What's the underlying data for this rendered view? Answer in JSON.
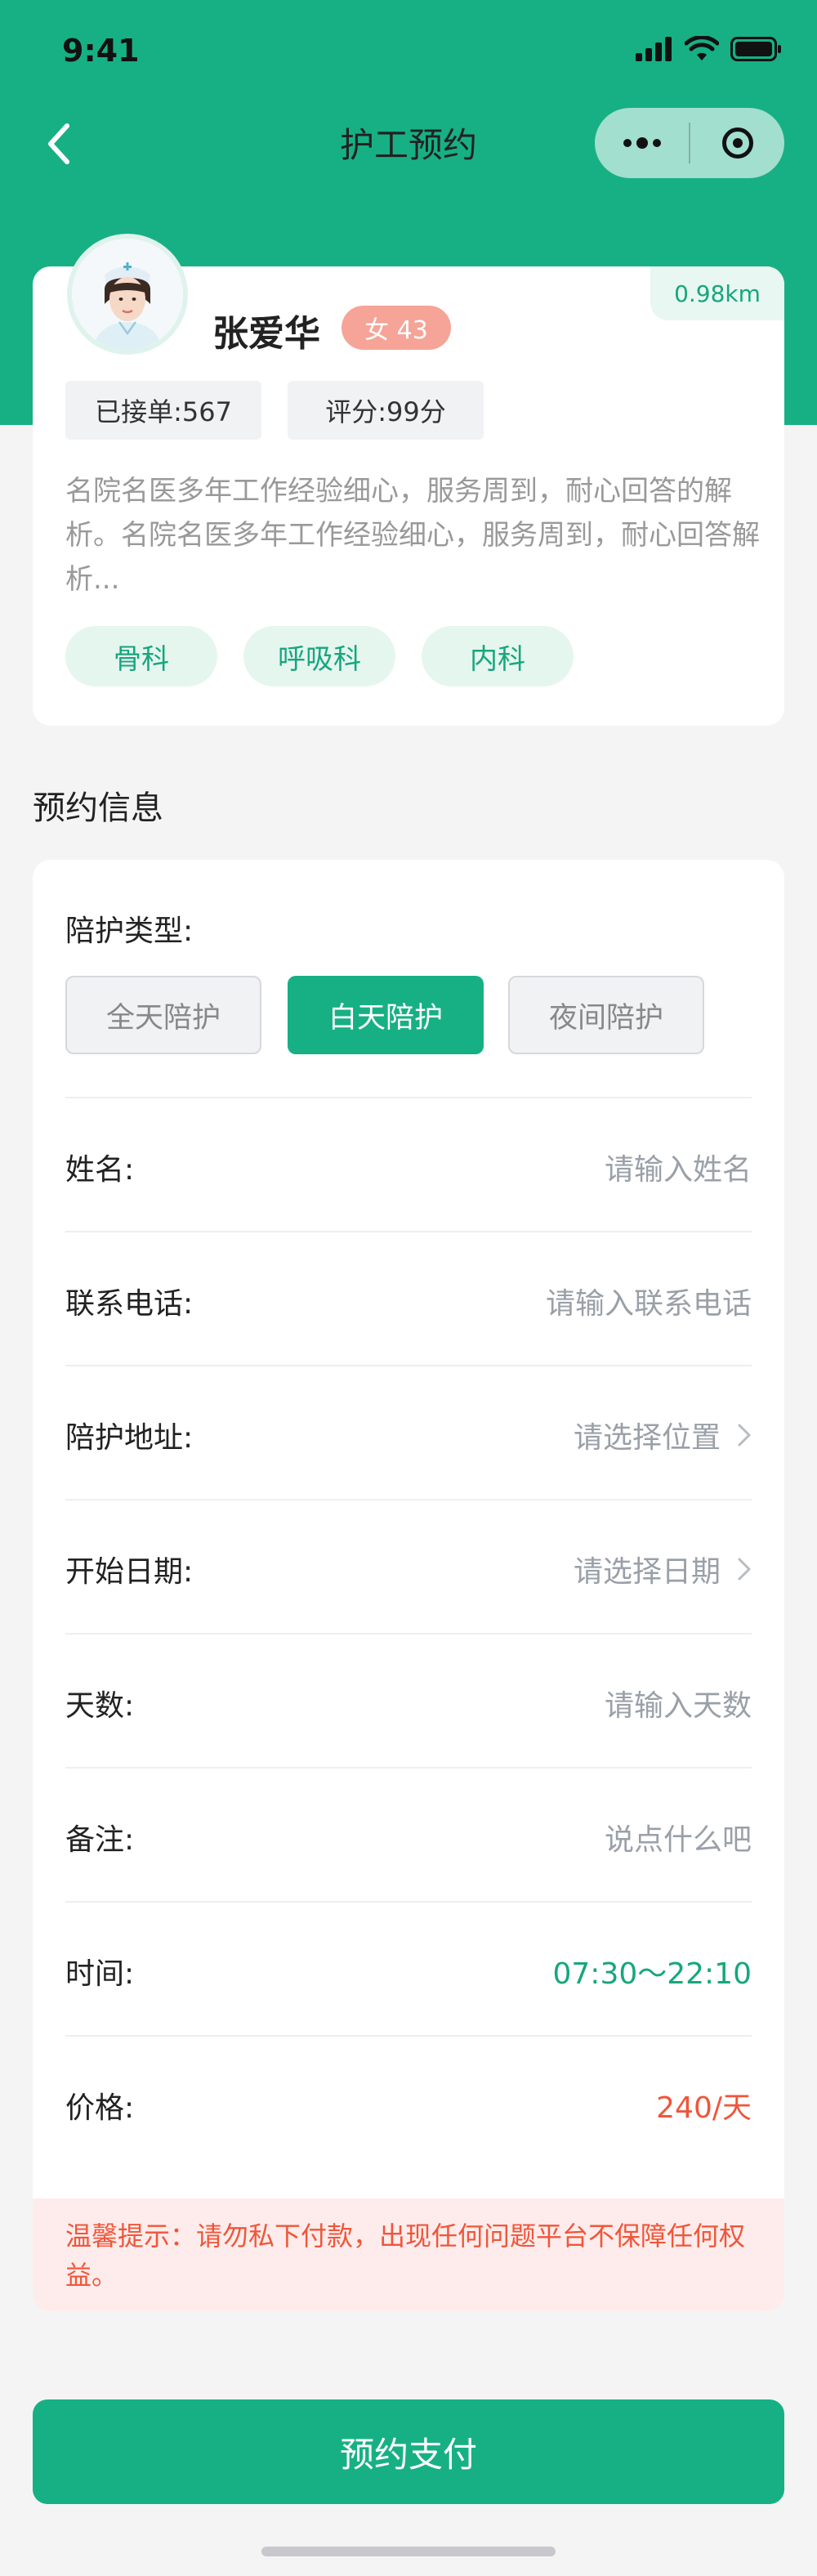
{
  "status_bar": {
    "time": "9:41"
  },
  "nav": {
    "title": "护工预约"
  },
  "profile": {
    "distance": "0.98km",
    "name": "张爱华",
    "gender_age": "女 43",
    "orders": "已接单:567",
    "rating": "评分:99分",
    "description": "名院名医多年工作经验细心，服务周到，耐心回答的解析。名院名医多年工作经验细心，服务周到，耐心回答解析...",
    "tags": [
      "骨科",
      "呼吸科",
      "内科"
    ]
  },
  "section_title": "预约信息",
  "form": {
    "care_type": {
      "label": "陪护类型:",
      "options": [
        "全天陪护",
        "白天陪护",
        "夜间陪护"
      ],
      "selected": "白天陪护"
    },
    "rows": [
      {
        "label": "姓名:",
        "value": "请输入姓名",
        "type": "input"
      },
      {
        "label": "联系电话:",
        "value": "请输入联系电话",
        "type": "input"
      },
      {
        "label": "陪护地址:",
        "value": "请选择位置",
        "type": "select"
      },
      {
        "label": "开始日期:",
        "value": "请选择日期",
        "type": "select"
      },
      {
        "label": "天数:",
        "value": "请输入天数",
        "type": "input"
      },
      {
        "label": "备注:",
        "value": "说点什么吧",
        "type": "input"
      },
      {
        "label": "时间:",
        "value": "07:30～22:10",
        "type": "text"
      },
      {
        "label": "价格:",
        "value": "240/天",
        "type": "text"
      }
    ],
    "notice": "温馨提示：请勿私下付款，出现任何问题平台不保障任何权益。"
  },
  "pay_button": "预约支付",
  "colors": {
    "brand": "#17b084",
    "price": "#f0563a",
    "gender_badge": "#f6a497"
  }
}
